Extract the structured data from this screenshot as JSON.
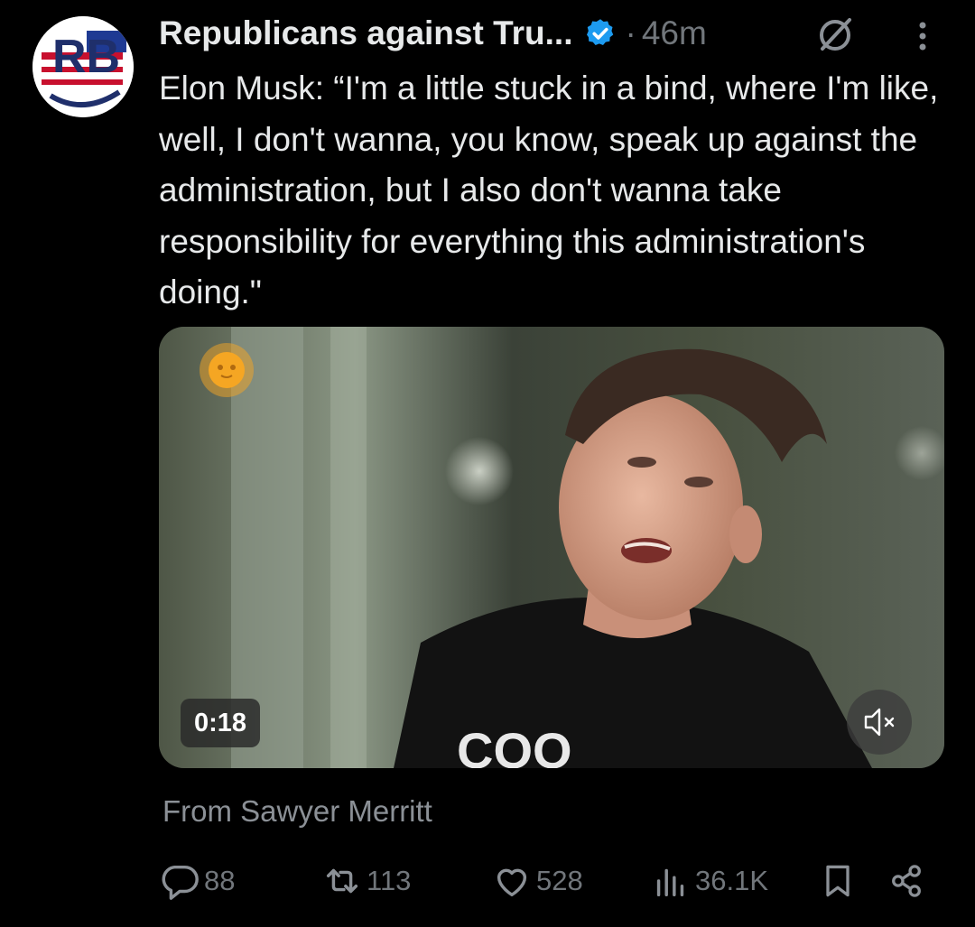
{
  "author": {
    "display_name": "Republicans against Tru...",
    "verified": true,
    "separator": "·",
    "time_ago": "46m",
    "avatar_letters": "RB"
  },
  "tweet": {
    "text": "Elon Musk: “I'm a little stuck in a bind, where I'm like, well, I don't wanna, you know, speak up against the administration, but I also don't wanna take responsibility for everything this administration's doing.\""
  },
  "media": {
    "type": "video",
    "duration": "0:18",
    "muted": true,
    "shirt_text": "COO"
  },
  "attribution": {
    "text": "From Sawyer Merritt"
  },
  "actions": {
    "replies": "88",
    "reposts": "113",
    "likes": "528",
    "views": "36.1K"
  },
  "colors": {
    "background": "#000000",
    "text_primary": "#e7e9ea",
    "text_secondary": "#71767b",
    "verified_blue": "#1d9bf0",
    "logo_orange": "#f5a623"
  },
  "icons": [
    "grok-icon",
    "more-icon",
    "verified-icon",
    "mute-icon",
    "reply-icon",
    "repost-icon",
    "like-icon",
    "views-icon",
    "bookmark-icon",
    "share-icon"
  ]
}
